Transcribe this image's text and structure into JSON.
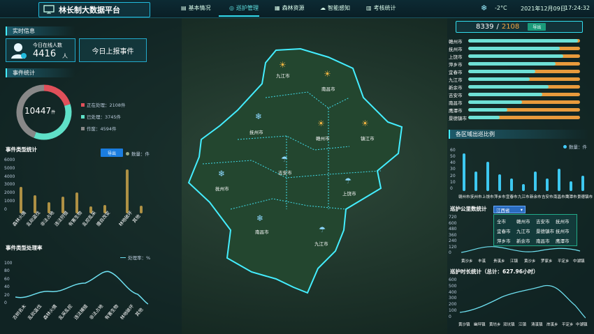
{
  "app": {
    "title": "林长制大数据平台"
  },
  "nav": [
    {
      "label": "基本情况"
    },
    {
      "label": "巡护管理"
    },
    {
      "label": "森林资源"
    },
    {
      "label": "智能感知"
    },
    {
      "label": "考核统计"
    }
  ],
  "weather": {
    "temp": "-2°C",
    "date": "2021年12月09日",
    "time": "17:24:32"
  },
  "realtime": {
    "section": "实时信息",
    "online_label": "今日在线人数",
    "online_count": "4416",
    "online_unit": "人",
    "report_button": "今日上报事件"
  },
  "events": {
    "section": "事件统计",
    "total": "10447",
    "unit": "件",
    "legend": [
      {
        "label": "正在处理：2108件",
        "color": "#e0505a",
        "value": 2108
      },
      {
        "label": "已处理：3745件",
        "color": "#5fe0c8",
        "value": 3745
      },
      {
        "label": "作废：4594件",
        "color": "#888888",
        "value": 4594
      }
    ]
  },
  "event_types": {
    "section": "事件类型统计",
    "export": "导出",
    "legend": "数量：件",
    "yaxis": [
      "6000",
      "5000",
      "4000",
      "3000",
      "2000",
      "1000",
      "0"
    ],
    "categories": [
      "森林火情",
      "乱砍盗伐",
      "非法占地",
      "违法狩猎",
      "有害生物",
      "乱挖乱采",
      "擅自改变",
      "林地破坏",
      "其他"
    ]
  },
  "event_rate": {
    "section": "事件类型处理率",
    "legend": "处理率：%",
    "yaxis": [
      "100",
      "80",
      "60",
      "40",
      "20",
      "0"
    ],
    "categories": [
      "古树名木",
      "乱砍盗伐",
      "森林火情",
      "乱采乱挖",
      "违法捕猎",
      "非法占地",
      "有害生物",
      "林地破坏",
      "其他"
    ]
  },
  "map": {
    "cities": [
      "九江市",
      "南昌市",
      "抚州市",
      "赣州市",
      "镇江市",
      "抚州市",
      "吉安市",
      "上饶市",
      "南昌市",
      "九江市"
    ]
  },
  "right_top": {
    "count": "8339",
    "total": "2108",
    "button": "导出",
    "rows": [
      {
        "city": "赣州市",
        "fill": 0.98
      },
      {
        "city": "抚州市",
        "fill": 0.82
      },
      {
        "city": "上饶市",
        "fill": 0.85
      },
      {
        "city": "萍乡市",
        "fill": 0.78
      },
      {
        "city": "宜春市",
        "fill": 0.6
      },
      {
        "city": "九江市",
        "fill": 0.55
      },
      {
        "city": "新余市",
        "fill": 0.72
      },
      {
        "city": "吉安市",
        "fill": 0.66
      },
      {
        "city": "南昌市",
        "fill": 0.48
      },
      {
        "city": "鹰潭市",
        "fill": 0.35
      },
      {
        "city": "景德镇市",
        "fill": 0.28
      }
    ]
  },
  "patrol_ratio": {
    "section": "各区域出巡比例",
    "legend": "数量：件",
    "yaxis": [
      "60",
      "50",
      "40",
      "30",
      "20",
      "10",
      "0"
    ],
    "categories": [
      "赣州市",
      "抚州市",
      "上饶市",
      "萍乡市",
      "宜春市",
      "九江市",
      "新余市",
      "吉安市",
      "南昌市",
      "鹰潭市",
      "景德镇市"
    ]
  },
  "patrol_km": {
    "section": "巡护公里数统计",
    "dropdown": "江西省",
    "yaxis": [
      "720",
      "600",
      "480",
      "360",
      "240",
      "120",
      "0"
    ],
    "xaxis": [
      "黄沙乡",
      "丰溪",
      "贵溪乡",
      "江镇",
      "黄沙乡",
      "罗家乡",
      "平定乡",
      "中湖镇"
    ],
    "options": [
      "全市",
      "赣州市",
      "吉安市",
      "抚州市",
      "宜春市",
      "九江市",
      "景德镇市",
      "抚州市",
      "萍乡市",
      "新余市",
      "南昌市",
      "鹰潭市"
    ]
  },
  "patrol_hours": {
    "section": "巡护时长统计（总计：627.96小时）",
    "yaxis": [
      "600",
      "500",
      "400",
      "300",
      "200",
      "100",
      "0"
    ],
    "xaxis": [
      "黄沙镇",
      "幽坪镇",
      "黄坊乡",
      "双坑镇",
      "江镇",
      "清溪镇",
      "岸溪乡",
      "平定乡",
      "中湖镇"
    ]
  }
}
